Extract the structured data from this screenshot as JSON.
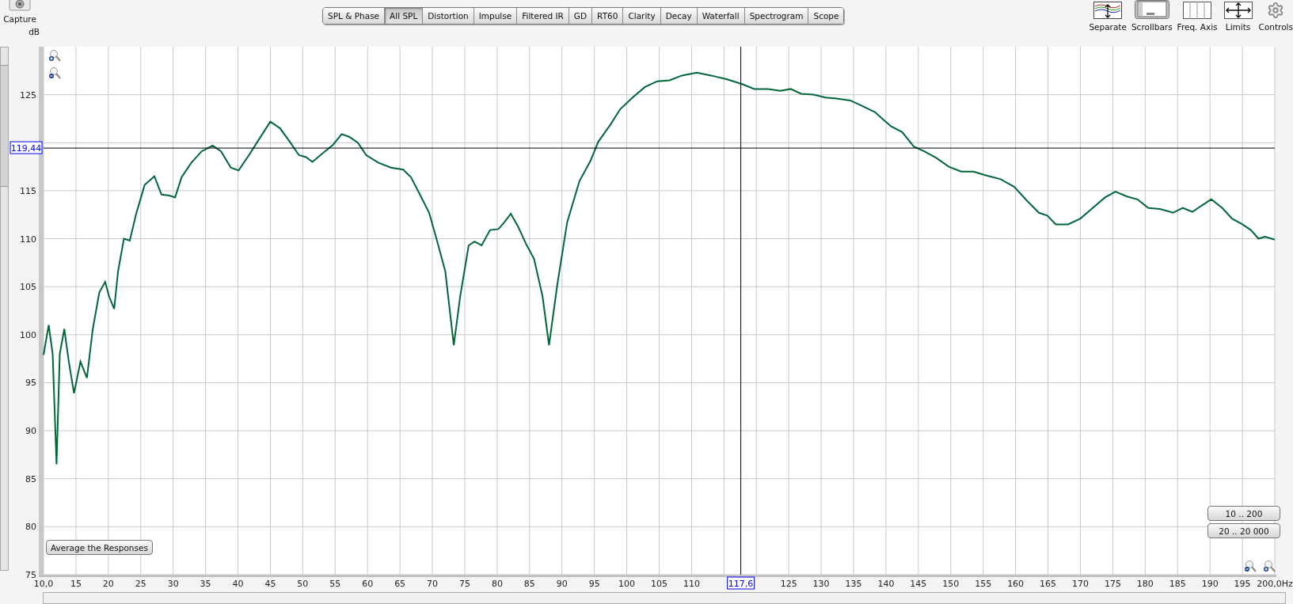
{
  "toolbar": {
    "capture": {
      "label": "Capture"
    },
    "tabs": [
      {
        "label": "SPL & Phase",
        "selected": false
      },
      {
        "label": "All SPL",
        "selected": true
      },
      {
        "label": "Distortion",
        "selected": false
      },
      {
        "label": "Impulse",
        "selected": false
      },
      {
        "label": "Filtered IR",
        "selected": false
      },
      {
        "label": "GD",
        "selected": false
      },
      {
        "label": "RT60",
        "selected": false
      },
      {
        "label": "Clarity",
        "selected": false
      },
      {
        "label": "Decay",
        "selected": false
      },
      {
        "label": "Waterfall",
        "selected": false
      },
      {
        "label": "Spectrogram",
        "selected": false
      },
      {
        "label": "Scope",
        "selected": false
      }
    ],
    "tools": [
      {
        "kind": "separate",
        "label": "Separate",
        "on": false
      },
      {
        "kind": "scrollbars",
        "label": "Scrollbars",
        "on": true
      },
      {
        "kind": "freq",
        "label": "Freq. Axis",
        "on": false
      },
      {
        "kind": "limits",
        "label": "Limits",
        "on": false
      },
      {
        "kind": "controls",
        "label": "Controls",
        "on": false
      }
    ]
  },
  "y_unit": "dB",
  "plot": {
    "average_button": "Average the Responses",
    "range_buttons": [
      "10 .. 200",
      "20 .. 20 000"
    ],
    "chart_data": {
      "type": "line",
      "xlim": [
        10,
        200
      ],
      "ylim": [
        75,
        130
      ],
      "xticks": [
        {
          "value": 10,
          "label": "10,0"
        },
        15,
        20,
        25,
        30,
        35,
        40,
        45,
        50,
        55,
        60,
        65,
        70,
        75,
        80,
        85,
        90,
        95,
        100,
        105,
        110,
        125,
        130,
        135,
        140,
        145,
        150,
        155,
        160,
        165,
        170,
        175,
        180,
        185,
        190,
        195,
        {
          "value": 200,
          "label": "200,0Hz"
        }
      ],
      "yticks": [
        75,
        80,
        85,
        90,
        95,
        100,
        105,
        110,
        115,
        125
      ],
      "x": [
        10,
        10.8,
        11.4,
        12,
        12.5,
        13.2,
        13.9,
        14.7,
        15.7,
        16.7,
        17.6,
        18.6,
        19.5,
        20.1,
        20.9,
        21.5,
        22.4,
        23.3,
        24.3,
        25.6,
        27.1,
        28.2,
        29.4,
        30.3,
        31.3,
        32.8,
        34.4,
        36.1,
        37.4,
        38.9,
        40.1,
        41.7,
        43.3,
        45,
        46.5,
        48,
        49.4,
        50.5,
        51.5,
        53.1,
        54.7,
        56,
        57.2,
        58.5,
        59.8,
        61.7,
        63.6,
        65.5,
        66.7,
        68,
        69.5,
        70.8,
        72,
        73.3,
        74.3,
        75.6,
        76.5,
        77.6,
        78.9,
        80.2,
        81.1,
        82.1,
        83.2,
        84.5,
        85.7,
        87,
        88,
        89.3,
        90.8,
        92.7,
        94.4,
        95.6,
        97.4,
        99,
        100.9,
        102.8,
        104.7,
        106.6,
        108.5,
        110.8,
        113,
        115.5,
        117.8,
        119.7,
        121.8,
        123.7,
        125.3,
        126.9,
        128.8,
        130.7,
        132.4,
        134.5,
        136.4,
        138.3,
        139.6,
        140.8,
        142.5,
        144.3,
        145.9,
        147.8,
        149.7,
        151.6,
        153.5,
        155.4,
        157.7,
        159.8,
        161.7,
        163.6,
        164.9,
        166.2,
        168.1,
        170,
        171.9,
        173.8,
        175.4,
        177.2,
        178.8,
        180.5,
        182.3,
        184.3,
        185.8,
        187.3,
        188.6,
        190.2,
        191.9,
        193.4,
        195,
        196.3,
        197.5,
        198.5,
        200
      ],
      "series": [
        {
          "color": "#00663a",
          "values": [
            97.9,
            101,
            98,
            86.5,
            98,
            100.6,
            97.2,
            93.9,
            97.2,
            95.5,
            100.6,
            104.4,
            105.5,
            104,
            102.7,
            106.6,
            110,
            109.8,
            112.6,
            115.6,
            116.5,
            114.6,
            114.5,
            114.3,
            116.4,
            117.9,
            119.1,
            119.7,
            119.1,
            117.4,
            117.1,
            118.7,
            120.4,
            122.2,
            121.5,
            120.1,
            118.7,
            118.5,
            118,
            118.9,
            119.8,
            120.9,
            120.6,
            120,
            118.7,
            117.9,
            117.4,
            117.2,
            116.4,
            114.7,
            112.7,
            109.6,
            106.6,
            98.9,
            104,
            109.3,
            109.7,
            109.3,
            110.9,
            111,
            111.7,
            112.6,
            111.3,
            109.4,
            107.9,
            104,
            98.9,
            105.3,
            111.7,
            116,
            118.1,
            120.1,
            121.8,
            123.5,
            124.7,
            125.8,
            126.4,
            126.5,
            127,
            127.3,
            127,
            126.6,
            126.1,
            125.6,
            125.6,
            125.4,
            125.6,
            125.1,
            125,
            124.7,
            124.6,
            124.4,
            123.8,
            123.2,
            122.4,
            121.7,
            121.1,
            119.6,
            119.1,
            118.4,
            117.5,
            117,
            117,
            116.6,
            116.2,
            115.4,
            114,
            112.7,
            112.4,
            111.5,
            111.5,
            112.1,
            113.2,
            114.3,
            114.9,
            114.4,
            114.1,
            113.2,
            113.1,
            112.7,
            113.2,
            112.8,
            113.4,
            114.1,
            113.2,
            112.1,
            111.5,
            110.9,
            110,
            110.2,
            109.9
          ]
        }
      ],
      "grid": true,
      "ref_lines": [
        {
          "axis": "x",
          "value": 117.6,
          "label": "117,6"
        },
        {
          "axis": "y",
          "value": 119.44,
          "label": "119,44"
        }
      ]
    }
  }
}
